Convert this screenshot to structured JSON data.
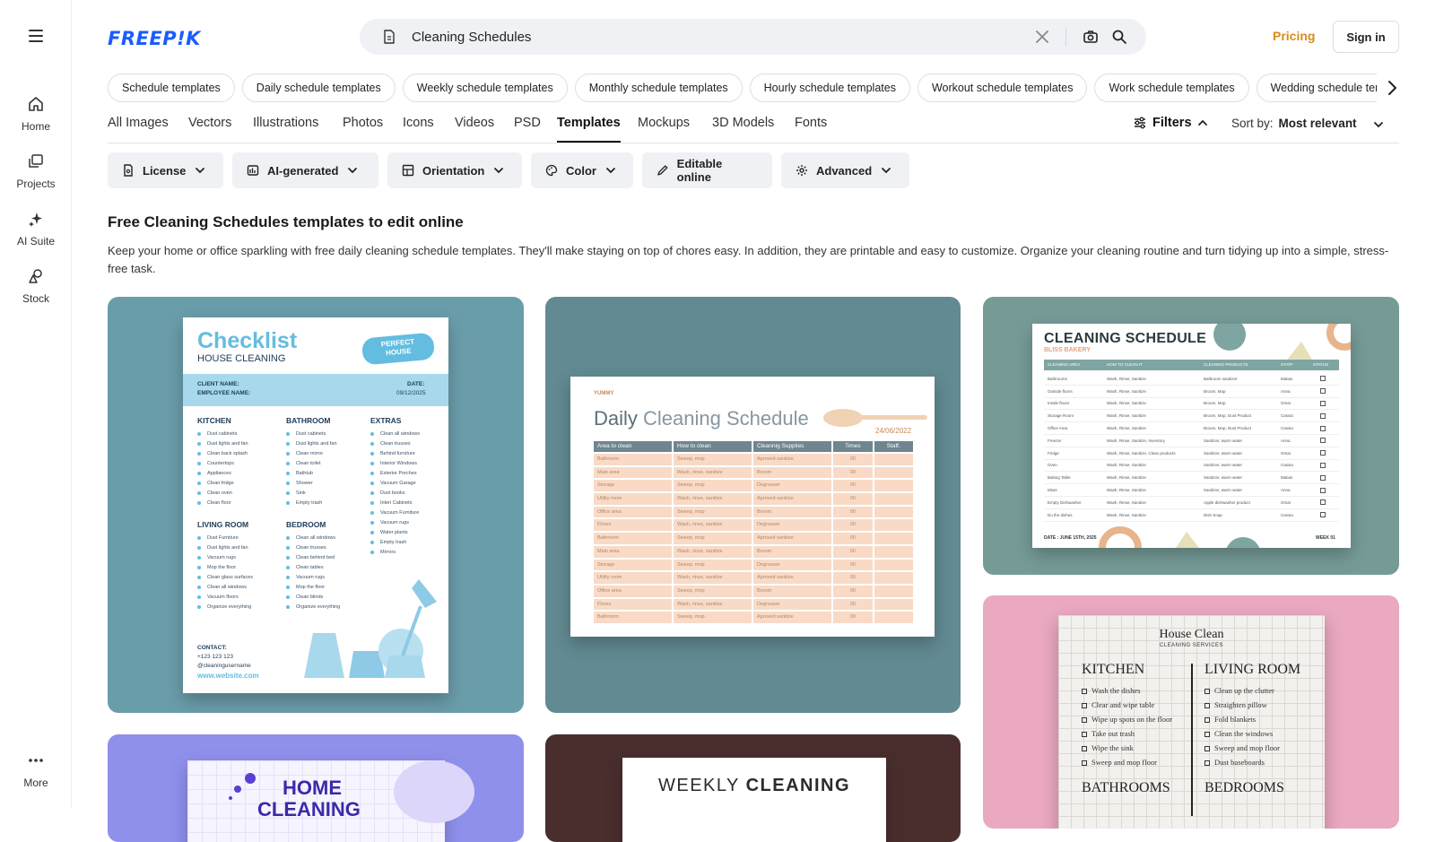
{
  "rail": {
    "items": [
      {
        "label": "Home"
      },
      {
        "label": "Projects"
      },
      {
        "label": "AI Suite"
      },
      {
        "label": "Stock"
      },
      {
        "label": "More"
      }
    ]
  },
  "header": {
    "logo": "FREEP!K",
    "search_value": "Cleaning Schedules",
    "pricing": "Pricing",
    "sign_in": "Sign in"
  },
  "chips": [
    "Schedule templates",
    "Daily schedule templates",
    "Weekly schedule templates",
    "Monthly schedule templates",
    "Hourly schedule templates",
    "Workout schedule templates",
    "Work schedule templates",
    "Wedding schedule templates"
  ],
  "tabs": [
    {
      "label": "All Images"
    },
    {
      "label": "Vectors"
    },
    {
      "label": "Illustrations"
    },
    {
      "label": "Photos"
    },
    {
      "label": "Icons"
    },
    {
      "label": "Videos"
    },
    {
      "label": "PSD"
    },
    {
      "label": "Templates"
    },
    {
      "label": "Mockups"
    },
    {
      "label": "3D Models"
    },
    {
      "label": "Fonts"
    }
  ],
  "filters_label": "Filters",
  "sort": {
    "label": "Sort by:",
    "value": "Most relevant"
  },
  "filter_buttons": [
    "License",
    "AI-generated",
    "Orientation",
    "Color",
    "Editable online",
    "Advanced"
  ],
  "heading": "Free Cleaning Schedules templates to edit online",
  "description": "Keep your home or office sparkling with free daily cleaning schedule templates. They'll make staying on top of chores easy. In addition, they are printable and easy to customize. Organize your cleaning routine and turn tidying up into a simple, stress-free task.",
  "colors": {
    "brand": "#1a5cff",
    "pricing": "#d98c1a",
    "card1_bg": "#6a9daa",
    "card2_bg": "#628a92",
    "card3_bg": "#769b97",
    "card4_bg": "#eaa8c1",
    "card5_bg": "#8f90ec",
    "card6_bg": "#4a2e2e"
  },
  "cards": {
    "checklist": {
      "title": "Checklist",
      "subtitle": "HOUSE CLEANING",
      "badge_line1": "PERFECT",
      "badge_line2": "HOUSE",
      "client": "CLIENT NAME:",
      "employee": "EMPLOYEE NAME:",
      "date_label": "DATE:",
      "date_value": "09/12/2025",
      "sections": [
        {
          "name": "KITCHEN",
          "items": [
            "Dust cabinets",
            "Dust lights and fan",
            "Clean back splash",
            "Countertops",
            "Appliances",
            "Clean fridge",
            "Clean oven",
            "Clean floor"
          ]
        },
        {
          "name": "BATHROOM",
          "items": [
            "Dust cabinets",
            "Dust lights and fan",
            "Clean mirror",
            "Clean toilet",
            "Bathtub",
            "Shower",
            "Sink",
            "Empty trash"
          ]
        },
        {
          "name": "EXTRAS",
          "items": [
            "Clean all windows",
            "Clean trusses",
            "Behind furniture",
            "Interior Windows",
            "Exterior Porches",
            "Vacuum Garage",
            "Dust books",
            "Interi Cabinets",
            "Vacuum Furniture",
            "Vacuum rugs",
            "Water plants",
            "Empty trash",
            "Mirrors"
          ]
        },
        {
          "name": "LIVING ROOM",
          "items": [
            "Dust Furniture",
            "Dust lights and fan",
            "Vacuum rugs",
            "Mop the floor",
            "Clean glass surfaces",
            "Clean all windows",
            "Vacuum floors",
            "Organize everything"
          ]
        },
        {
          "name": "BEDROOM",
          "items": [
            "Clean all windows",
            "Clean trusses",
            "Clean behind bed",
            "Clean tables",
            "Vacuum rugs",
            "Mop the floor",
            "Clean blinds",
            "Organize everything"
          ]
        }
      ],
      "contact_label": "CONTACT:",
      "phone": "+123 123 123",
      "username": "@cleaningusername",
      "website": "www.website.com"
    },
    "daily": {
      "brand": "YUMMY",
      "title_a": "Daily",
      "title_b": "Cleaning Schedule",
      "date": "24/06/2022",
      "headers": [
        "Area to clean",
        "How to clean",
        "Cleannig Supplies",
        "Times",
        "Staff."
      ],
      "rows": [
        [
          "Bathroom",
          "Sweep, mop",
          "Aproved sanitize",
          "00",
          ""
        ],
        [
          "Main area",
          "Wash, rinse, sanitize",
          "Broom",
          "00",
          ""
        ],
        [
          "Storage",
          "Sweep, mop",
          "Degreaser",
          "00",
          ""
        ],
        [
          "Utility room",
          "Wash, rinse, sanitize",
          "Aproved sanitize",
          "00",
          ""
        ],
        [
          "Office area",
          "Sweep, mop",
          "Broom",
          "00",
          ""
        ],
        [
          "Floors",
          "Wash, rinse, sanitize",
          "Degreaser",
          "00",
          ""
        ],
        [
          "Bathroom",
          "Sweep, mop",
          "Aproved sanitize",
          "00",
          ""
        ],
        [
          "Main area",
          "Wash, rinse, sanitize",
          "Broom",
          "00",
          ""
        ],
        [
          "Storage",
          "Sweep, mop",
          "Degreaser",
          "00",
          ""
        ],
        [
          "Utility room",
          "Wash, rinse, sanitize",
          "Aproved sanitize",
          "00",
          ""
        ],
        [
          "Office area",
          "Sweep, mop",
          "Broom",
          "00",
          ""
        ],
        [
          "Floors",
          "Wash, rinse, sanitize",
          "Degreaser",
          "00",
          ""
        ],
        [
          "Bathroom",
          "Sweep, mop",
          "Aproved sanitize",
          "00",
          ""
        ]
      ]
    },
    "bliss": {
      "title": "CLEANING SCHEDULE",
      "subtitle": "BLISS BAKERY",
      "headers": [
        "CLEANING AREA",
        "HOW TO CLEAN IT",
        "CLEANING PRODUCTS",
        "STAFF",
        "STATUS"
      ],
      "rows": [
        [
          "Bathrooms",
          "Wash, Rinse, Sanitize",
          "Bathroom sanitizer",
          "Matias"
        ],
        [
          "Outside floors",
          "Wash, Rinse, Sanitize",
          "Broom, Mop",
          "Anna"
        ],
        [
          "Inside floors",
          "Wash, Rinse, Sanitize",
          "Broom, Mop",
          "Omar"
        ],
        [
          "Storage Room",
          "Wash, Rinse, Sanitize",
          "Broom, Mop, Dust Product",
          "Cassia"
        ],
        [
          "Office Area",
          "Wash, Rinse, Sanitize",
          "Broom, Mop, Dust Product",
          "Cassia"
        ],
        [
          "Freezer",
          "Wash, Rinse, Sanitize, Inventory",
          "Sanitizer, warm water",
          "Anna"
        ],
        [
          "Fridge",
          "Wash, Rinse, Sanitize, Clean products",
          "Sanitizer, warm water",
          "Omar"
        ],
        [
          "Oven",
          "Wash, Rinse, Sanitize",
          "Sanitizer, warm water",
          "Cassia"
        ],
        [
          "Baking Table",
          "Wash, Rinse, Sanitize",
          "Sanitizer, warm water",
          "Matias"
        ],
        [
          "Mixer",
          "Wash, Rinse, Sanitize",
          "Sanitizer, warm water",
          "Anna"
        ],
        [
          "Empty Dishwasher",
          "Wash, Rinse, Sanitize",
          "Apple dishwasher product",
          "Omar"
        ],
        [
          "Do the dishes",
          "Wash, Rinse, Sanitize",
          "Dish Soap",
          "Cassia"
        ]
      ],
      "footer_date": "DATE : JUNE 15TH, 2025",
      "footer_week": "WEEK 01"
    },
    "houseclean": {
      "title": "House Clean",
      "subtitle": "CLEANING SERVICES",
      "kitchen": "KITCHEN",
      "kitchen_items": [
        "Wash the dishes",
        "Clear and wipe table",
        "Wipe up spots on the floor",
        "Take out trash",
        "Wipe the sink",
        "Sweep and mop floor"
      ],
      "living": "LIVING ROOM",
      "living_items": [
        "Clean up the clutter",
        "Straighten pillow",
        "Fold blankets",
        "Clean the windows",
        "Sweep and mop floor",
        "Dust baseboards"
      ],
      "bathrooms": "BATHROOMS",
      "bedrooms": "BEDROOMS"
    },
    "home": {
      "line1": "HOME",
      "line2": "CLEANING"
    },
    "weekly": {
      "title_a": "WEEKLY ",
      "title_b": "CLEANING"
    }
  }
}
